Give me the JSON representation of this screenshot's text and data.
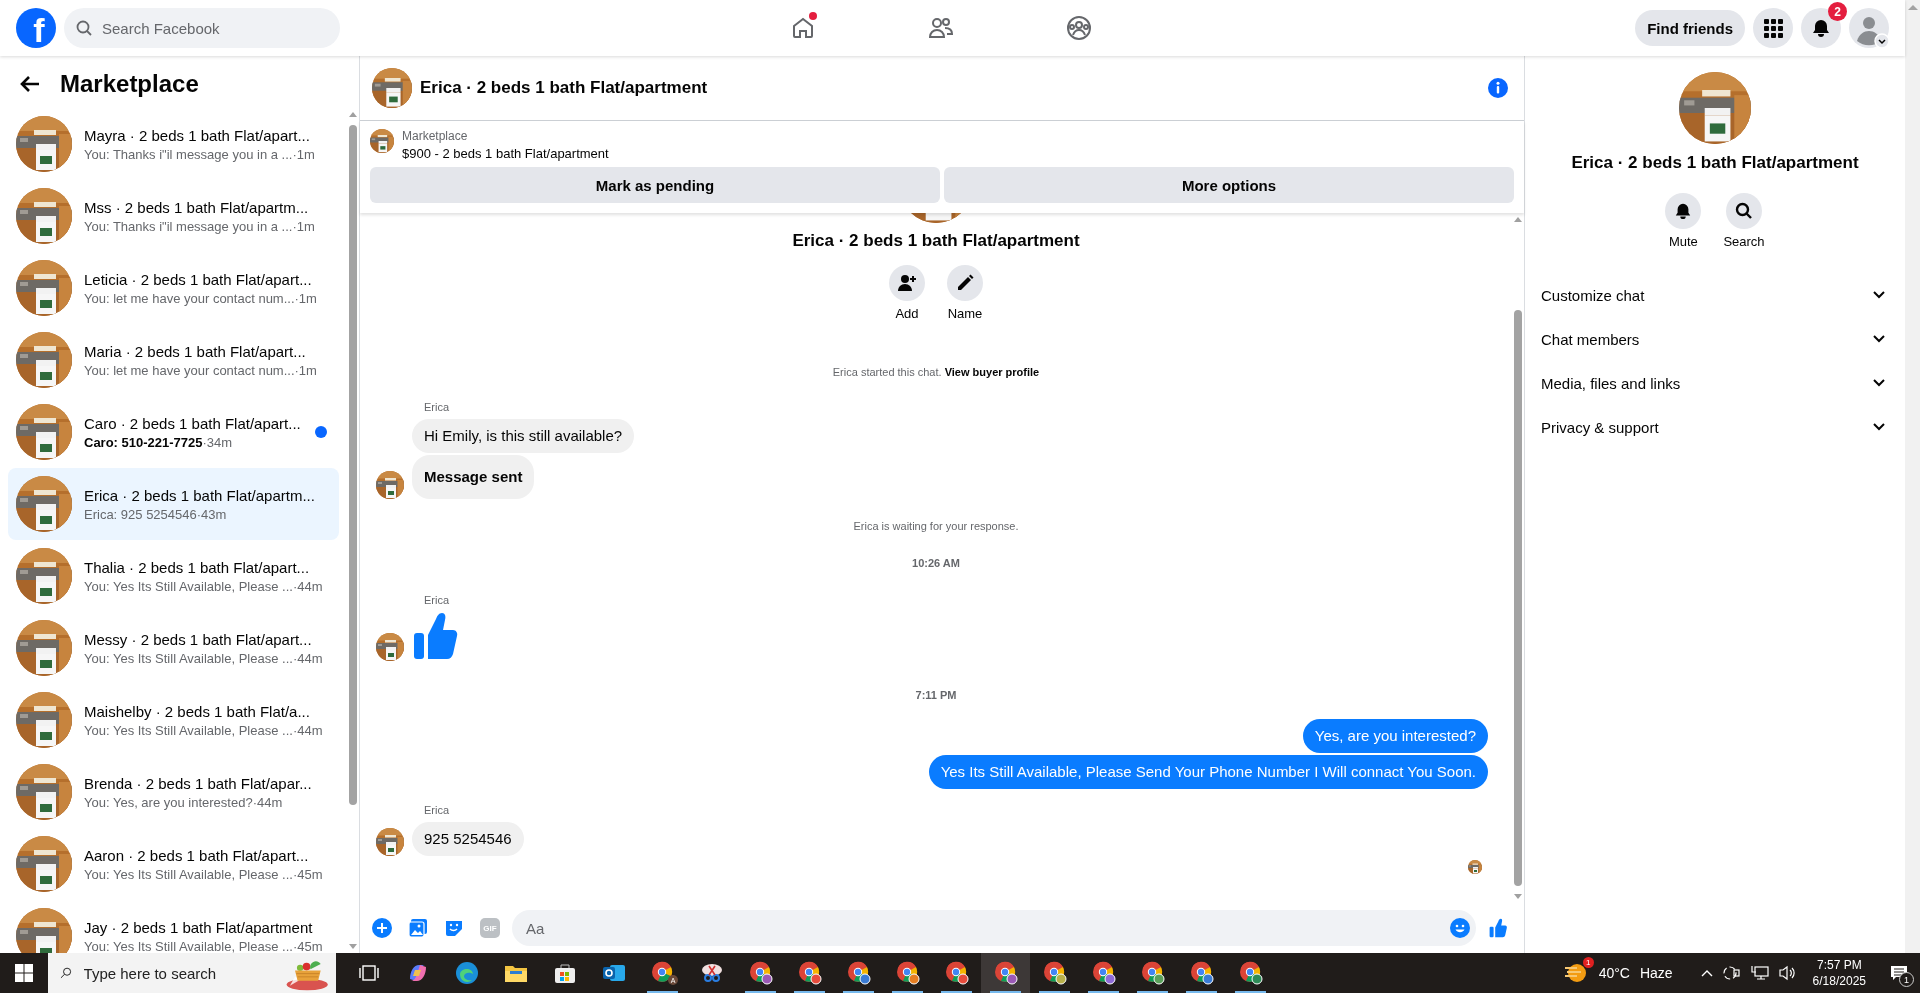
{
  "top_bar": {
    "logo": "f",
    "search": {
      "placeholder": "Search Facebook"
    },
    "nav": [
      {
        "kind": "home",
        "dot": true
      },
      {
        "kind": "friends",
        "dot": false
      },
      {
        "kind": "groups",
        "dot": false
      }
    ],
    "find_friends": "Find friends",
    "notification_count": "2"
  },
  "sidebar": {
    "title": "Marketplace",
    "conversations": [
      {
        "title": "Mayra · 2 beds 1 bath Flat/apart...",
        "preview": "You: Thanks i\"il message you in a ...",
        "time": " ·1m",
        "unread": false,
        "selected": false
      },
      {
        "title": "Mss · 2 beds 1 bath Flat/apartm...",
        "preview": "You: Thanks i\"il message you in a ...",
        "time": " ·1m",
        "unread": false,
        "selected": false
      },
      {
        "title": "Leticia · 2 beds 1 bath Flat/apart...",
        "preview": "You: let me have your contact num...",
        "time": "·1m",
        "unread": false,
        "selected": false
      },
      {
        "title": "Maria · 2 beds 1 bath Flat/apart...",
        "preview": "You: let me have your contact num...",
        "time": "·1m",
        "unread": false,
        "selected": false
      },
      {
        "title": "Caro · 2 beds 1 bath Flat/apart...",
        "preview": "Caro: 510-221-7725",
        "time": "·34m",
        "unread": true,
        "selected": false
      },
      {
        "title": "Erica · 2 beds 1 bath Flat/apartm...",
        "preview": "Erica: 925 5254546",
        "time": "·43m",
        "unread": false,
        "selected": true
      },
      {
        "title": "Thalia · 2 beds 1 bath Flat/apart...",
        "preview": "You: Yes Its Still Available, Please ...",
        "time": " ·44m",
        "unread": false,
        "selected": false
      },
      {
        "title": "Messy · 2 beds 1 bath Flat/apart...",
        "preview": "You: Yes Its Still Available, Please ...",
        "time": " ·44m",
        "unread": false,
        "selected": false
      },
      {
        "title": "Maishelby · 2 beds 1 bath Flat/a...",
        "preview": "You: Yes Its Still Available, Please ...",
        "time": " ·44m",
        "unread": false,
        "selected": false
      },
      {
        "title": "Brenda · 2 beds 1 bath Flat/apar...",
        "preview": "You: Yes, are you interested?",
        "time": "·44m",
        "unread": false,
        "selected": false
      },
      {
        "title": "Aaron · 2 beds 1 bath Flat/apart...",
        "preview": "You: Yes Its Still Available, Please ...",
        "time": " ·45m",
        "unread": false,
        "selected": false
      },
      {
        "title": "Jay · 2 beds 1 bath Flat/apartment",
        "preview": "You: Yes Its Still Available, Please ...",
        "time": " ·45m",
        "unread": false,
        "selected": false
      }
    ]
  },
  "chat": {
    "title": "Erica · 2 beds 1 bath Flat/apartment",
    "listing": {
      "label": "Marketplace",
      "title": "$900 - 2 beds 1 bath Flat/apartment",
      "buttons": [
        "Mark as pending",
        "More options"
      ]
    },
    "intro": {
      "title": "Erica · 2 beds 1 bath Flat/apartment",
      "actions": [
        {
          "kind": "add",
          "label": "Add"
        },
        {
          "kind": "name",
          "label": "Name"
        }
      ]
    },
    "timeline": [
      {
        "kind": "notice",
        "text": "Erica started this chat.",
        "link": "View buyer profile"
      },
      {
        "kind": "sender",
        "text": "Erica"
      },
      {
        "kind": "incoming",
        "text": "Hi Emily, is this still available?",
        "avatar": false,
        "emphasis": false
      },
      {
        "kind": "incoming",
        "text": "Message sent",
        "avatar": true,
        "emphasis": true
      },
      {
        "kind": "notice",
        "text": "Erica is waiting for your response."
      },
      {
        "kind": "time",
        "text": "10:26 AM"
      },
      {
        "kind": "sender",
        "text": "Erica"
      },
      {
        "kind": "like",
        "avatar": true
      },
      {
        "kind": "time",
        "text": "7:11 PM"
      },
      {
        "kind": "outgoing",
        "text": "Yes, are you interested?"
      },
      {
        "kind": "outgoing",
        "text": "Yes Its Still Available, Please Send Your Phone Number I Will connact You Soon."
      },
      {
        "kind": "sender",
        "text": "Erica"
      },
      {
        "kind": "incoming",
        "text": "925 5254546",
        "avatar": true,
        "emphasis": false
      },
      {
        "kind": "seen"
      }
    ],
    "composer": {
      "gif_label": "GIF",
      "placeholder": "Aa"
    }
  },
  "details": {
    "title": "Erica · 2 beds 1 bath Flat/apartment",
    "actions": [
      {
        "kind": "mute",
        "label": "Mute"
      },
      {
        "kind": "search",
        "label": "Search"
      }
    ],
    "sections": [
      {
        "label": "Customize chat",
        "expanded": false
      },
      {
        "label": "Chat members",
        "expanded": false
      },
      {
        "label": "Media, files and links",
        "expanded": false
      },
      {
        "label": "Privacy & support",
        "expanded": false
      }
    ]
  },
  "taskbar": {
    "search": {
      "placeholder": "Type here to search"
    },
    "apps": [
      {
        "kind": "task-view",
        "running": false,
        "selected": false
      },
      {
        "kind": "ribbon",
        "running": false,
        "selected": false
      },
      {
        "kind": "wave",
        "running": false,
        "selected": false
      },
      {
        "kind": "folder",
        "running": false,
        "selected": false
      },
      {
        "kind": "bag",
        "running": false,
        "selected": false
      },
      {
        "kind": "mail",
        "running": false,
        "selected": false
      },
      {
        "kind": "browser",
        "label": "A",
        "running": true,
        "selected": false
      },
      {
        "kind": "scissors",
        "running": false,
        "selected": false
      },
      {
        "kind": "browser",
        "running": true,
        "selected": false
      },
      {
        "kind": "browser",
        "running": true,
        "selected": false
      },
      {
        "kind": "browser",
        "running": true,
        "selected": false
      },
      {
        "kind": "browser",
        "running": true,
        "selected": false
      },
      {
        "kind": "browser",
        "running": true,
        "selected": false
      },
      {
        "kind": "browser",
        "running": true,
        "selected": true
      },
      {
        "kind": "browser",
        "running": true,
        "selected": false
      },
      {
        "kind": "browser",
        "running": true,
        "selected": false
      },
      {
        "kind": "browser",
        "running": true,
        "selected": false
      },
      {
        "kind": "browser",
        "running": true,
        "selected": false
      },
      {
        "kind": "browser",
        "running": true,
        "selected": false
      }
    ],
    "weather_badge": "1",
    "temperature": "40°C",
    "condition": "Haze",
    "time": "7:57 PM",
    "date": "6/18/2025",
    "notification_count": "1"
  }
}
